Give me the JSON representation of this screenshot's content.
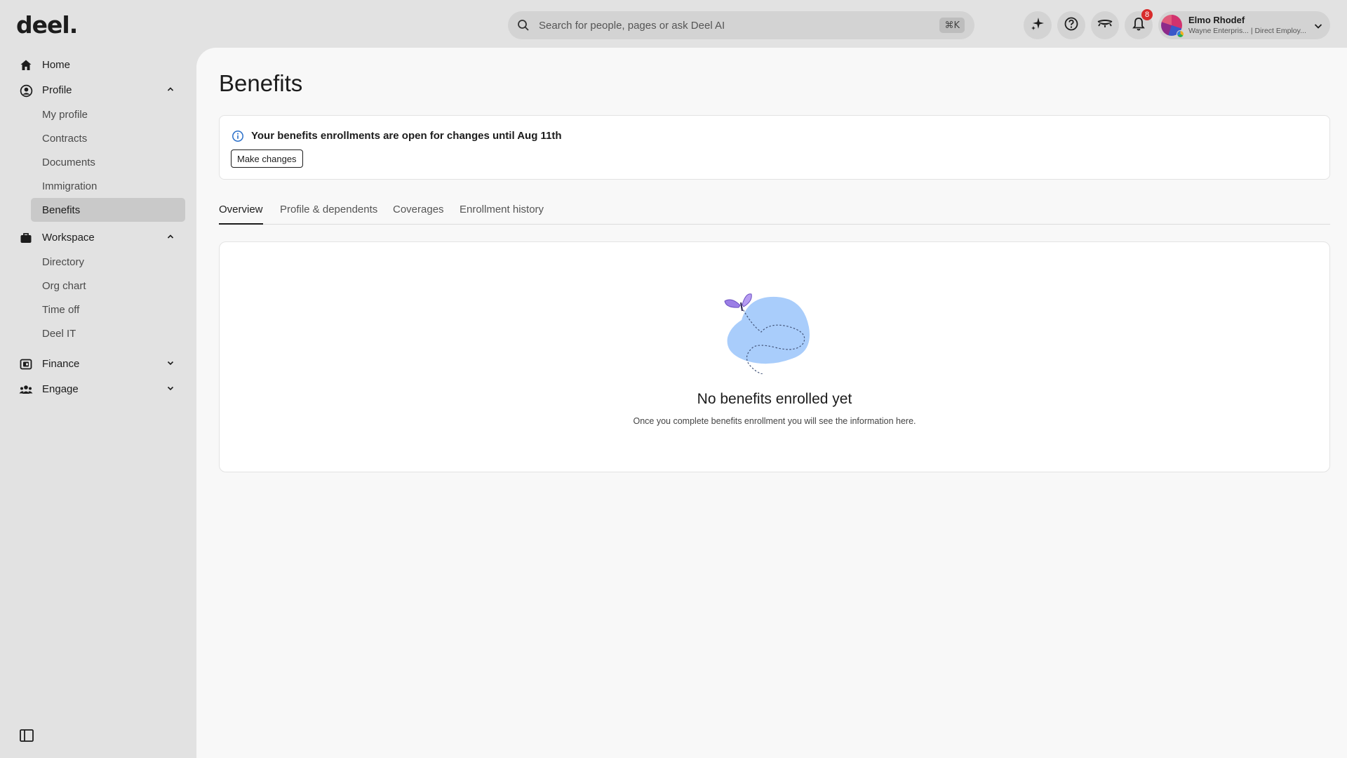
{
  "app": {
    "logo": "deel."
  },
  "search": {
    "placeholder": "Search for people, pages or ask Deel AI",
    "shortcut": "⌘K"
  },
  "topbar": {
    "icons": [
      "ai-sparkle-icon",
      "help-icon",
      "eye-closed-icon",
      "bell-icon"
    ],
    "notifications_count": "8",
    "user": {
      "name": "Elmo Rhodef",
      "org": "Wayne Enterpris... | Direct Employ..."
    }
  },
  "sidebar": {
    "home": "Home",
    "profile": {
      "label": "Profile",
      "items": [
        "My profile",
        "Contracts",
        "Documents",
        "Immigration",
        "Benefits"
      ]
    },
    "workspace": {
      "label": "Workspace",
      "items": [
        "Directory",
        "Org chart",
        "Time off",
        "Deel IT"
      ]
    },
    "finance": "Finance",
    "engage": "Engage"
  },
  "page": {
    "title": "Benefits",
    "notice": {
      "text": "Your benefits enrollments are open for changes until Aug 11th",
      "button": "Make changes"
    },
    "tabs": [
      "Overview",
      "Profile & dependents",
      "Coverages",
      "Enrollment history"
    ],
    "empty": {
      "title": "No benefits enrolled yet",
      "subtitle": "Once you complete benefits enrollment you will see the information here."
    }
  },
  "colors": {
    "shell_bg": "#e2e2e2",
    "panel_bg": "#f8f8f8",
    "active_item_bg": "#c9c9c9",
    "badge_red": "#d82c2c",
    "illustration_blob": "#a9cdfb",
    "butterfly_purple": "#9b7ee6"
  }
}
